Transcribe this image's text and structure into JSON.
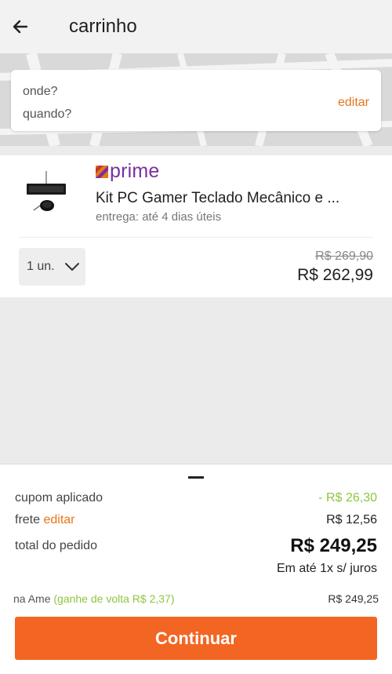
{
  "header": {
    "title": "carrinho"
  },
  "location": {
    "where": "onde?",
    "when": "quando?",
    "edit_label": "editar"
  },
  "product": {
    "brand": "prime",
    "title": "Kit PC Gamer Teclado Mecânico e ...",
    "delivery": "entrega: até 4 dias úteis",
    "quantity": "1 un.",
    "old_price": "R$ 269,90",
    "price": "R$ 262,99"
  },
  "summary": {
    "coupon_label": "cupom aplicado",
    "coupon_value": "- R$ 26,30",
    "frete_label": "frete",
    "frete_edit": "editar",
    "frete_value": "R$ 12,56",
    "total_label": "total do pedido",
    "total_value": "R$ 249,25",
    "installments": "Em até 1x s/ juros",
    "ame_label": "na Ame",
    "ame_cashback": "(ganhe de volta R$ 2,37)",
    "ame_value": "R$ 249,25",
    "continue_label": "Continuar"
  },
  "colors": {
    "accent_orange": "#f26522",
    "link_orange": "#e5761a",
    "prime_purple": "#7b2ea0",
    "cashback_green": "#8cc63f"
  },
  "icons": {
    "back": "arrow-left-icon",
    "chevron": "chevron-down-icon",
    "prime": "prime-logo-icon"
  }
}
